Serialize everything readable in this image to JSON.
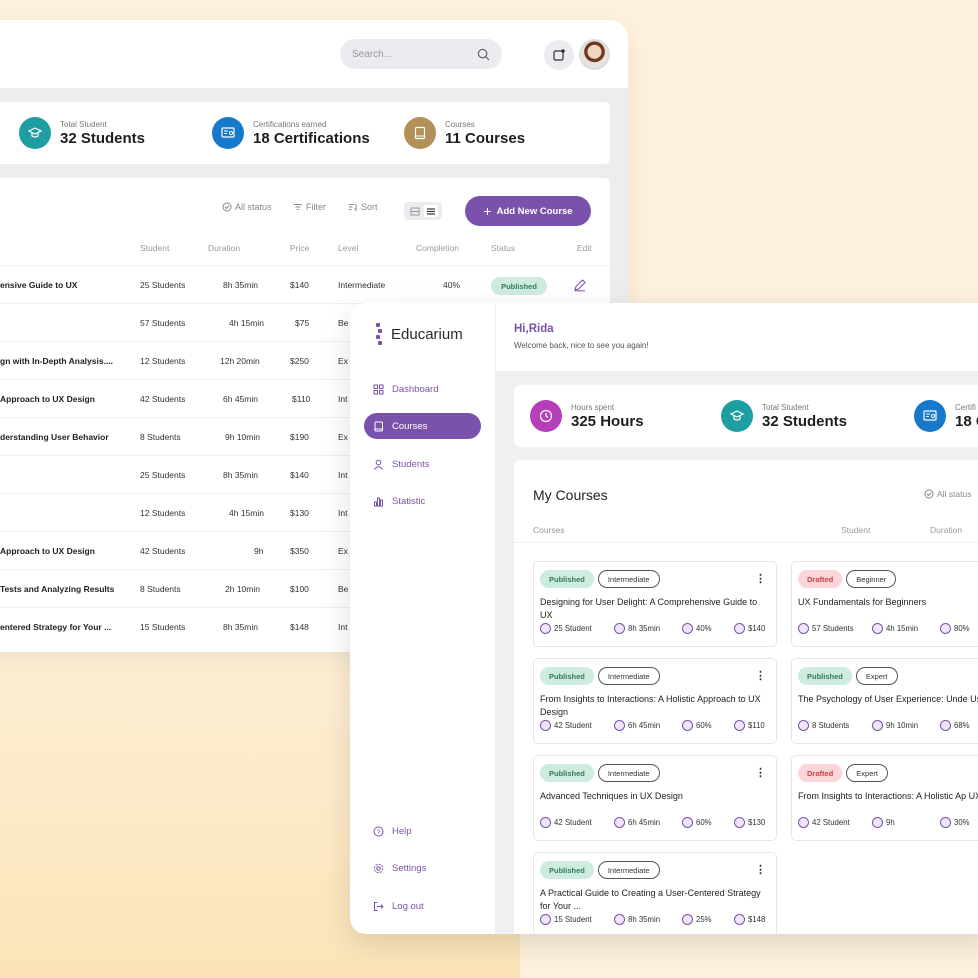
{
  "back": {
    "search_placeholder": "Search...",
    "stats": [
      {
        "label": "Total Student",
        "value": "32 Students",
        "color": "#1f9ea1"
      },
      {
        "label": "Certifications earned",
        "value": "18 Certifications",
        "color": "#1679c9"
      },
      {
        "label": "Courses",
        "value": "11 Courses",
        "color": "#b39057"
      }
    ],
    "toolbar": {
      "all_status": "All status",
      "filter": "Filter",
      "sort": "Sort",
      "add": "Add New Course"
    },
    "headers": {
      "student": "Student",
      "duration": "Duration",
      "price": "Price",
      "level": "Level",
      "completion": "Completion",
      "status": "Status",
      "edit": "Edit"
    },
    "rows": [
      {
        "title": "ensive Guide to UX",
        "student": "25 Students",
        "duration": "8h 35min",
        "price": "$140",
        "level": "Intermediate",
        "completion": "40%",
        "status": "Published"
      },
      {
        "title": "",
        "student": "57 Students",
        "duration": "4h 15min",
        "price": "$75",
        "level": "Be"
      },
      {
        "title": "gn with In-Depth Analysis....",
        "student": "12 Students",
        "duration": "12h 20min",
        "price": "$250",
        "level": "Ex"
      },
      {
        "title": "Approach to UX Design",
        "student": "42 Students",
        "duration": "6h 45min",
        "price": "$110",
        "level": "Int"
      },
      {
        "title": "derstanding User Behavior",
        "student": "8 Students",
        "duration": "9h 10min",
        "price": "$190",
        "level": "Ex"
      },
      {
        "title": "",
        "student": "25 Students",
        "duration": "8h 35min",
        "price": "$140",
        "level": "Int"
      },
      {
        "title": "",
        "student": "12 Students",
        "duration": "4h 15min",
        "price": "$130",
        "level": "Int"
      },
      {
        "title": "Approach to UX Design",
        "student": "42 Students",
        "duration": "9h",
        "price": "$350",
        "level": "Ex"
      },
      {
        "title": "Tests and Analyzing Results",
        "student": "8 Students",
        "duration": "2h 10min",
        "price": "$100",
        "level": "Be"
      },
      {
        "title": "entered Strategy for Your ...",
        "student": "15 Students",
        "duration": "8h 35min",
        "price": "$148",
        "level": "Int"
      }
    ]
  },
  "front": {
    "brand": "Educarium",
    "nav": [
      "Dashboard",
      "Courses",
      "Students",
      "Statistic"
    ],
    "nav_bottom": [
      "Help",
      "Settings",
      "Log out"
    ],
    "greeting": "Hi,Rida",
    "greeting_sub": "Welcome back, nice to see you again!",
    "stats": [
      {
        "label": "Hours spent",
        "value": "325 Hours",
        "color": "#b43fb8"
      },
      {
        "label": "Total Student",
        "value": "32 Students",
        "color": "#1f9ea1"
      },
      {
        "label": "Certifi",
        "value": "18 C",
        "color": "#1679c9"
      }
    ],
    "my_courses": "My Courses",
    "all_status": "All status",
    "headers": {
      "courses": "Courses",
      "student": "Student",
      "duration": "Duration"
    },
    "cards": [
      {
        "status": "Published",
        "level": "Intermediate",
        "title": "Designing for User Delight: A Comprehensive Guide to UX",
        "student": "25 Student",
        "duration": "8h 35min",
        "completion": "40%",
        "price": "$140"
      },
      {
        "status": "Drafted",
        "level": "Beginner",
        "title": "UX Fundamentals for Beginners",
        "student": "57 Students",
        "duration": "4h 15min",
        "completion": "80%",
        "price": ""
      },
      {
        "status": "Published",
        "level": "Intermediate",
        "title": "From Insights to Interactions: A Holistic Approach to UX Design",
        "student": "42 Student",
        "duration": "6h 45min",
        "completion": "60%",
        "price": "$110"
      },
      {
        "status": "Published",
        "level": "Expert",
        "title": "The Psychology of User Experience: Unde User Behavior",
        "student": "8 Students",
        "duration": "9h 10min",
        "completion": "68%",
        "price": ""
      },
      {
        "status": "Published",
        "level": "Intermediate",
        "title": "Advanced Techniques in UX Design",
        "student": "42 Student",
        "duration": "6h 45min",
        "completion": "60%",
        "price": "$130"
      },
      {
        "status": "Drafted",
        "level": "Expert",
        "title": "From Insights to Interactions: A Holistic Ap UX Design",
        "student": "42 Student",
        "duration": "9h",
        "completion": "30%",
        "price": ""
      },
      {
        "status": "Published",
        "level": "Intermediate",
        "title": "A Practical Guide to Creating a User-Centered Strategy for Your ...",
        "student": "15 Student",
        "duration": "8h 35min",
        "completion": "25%",
        "price": "$148"
      }
    ]
  }
}
